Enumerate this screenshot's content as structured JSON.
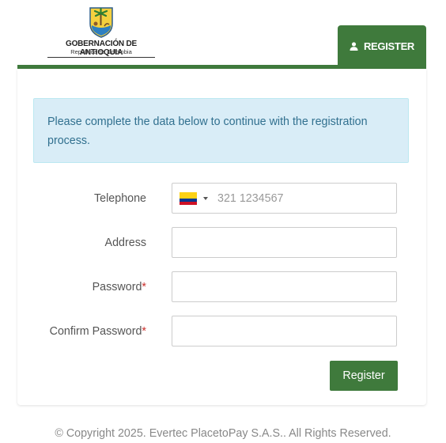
{
  "brand": {
    "organization": "GOBERNACIÓN DE ANTIOQUIA",
    "subtitle": "República de Colombia",
    "logo_icon": "antioquia-coat-of-arms-icon"
  },
  "header": {
    "tab_label": "REGISTER",
    "tab_icon": "user-icon",
    "accent_color": "#3f7a3c"
  },
  "alert": {
    "message": "Please complete the data below to continue with the registration process."
  },
  "form": {
    "telephone": {
      "label": "Telephone",
      "country_flag": "colombia-flag-icon",
      "placeholder": "321 1234567",
      "value": ""
    },
    "address": {
      "label": "Address",
      "value": ""
    },
    "password": {
      "label": "Password",
      "required_marker": "*",
      "value": ""
    },
    "confirm_password": {
      "label": "Confirm Password",
      "required_marker": "*",
      "value": ""
    },
    "submit_label": "Register"
  },
  "footer": {
    "copyright": "© Copyright 2025. Evertec PlacetoPay S.A.S.. All Rights Reserved."
  }
}
